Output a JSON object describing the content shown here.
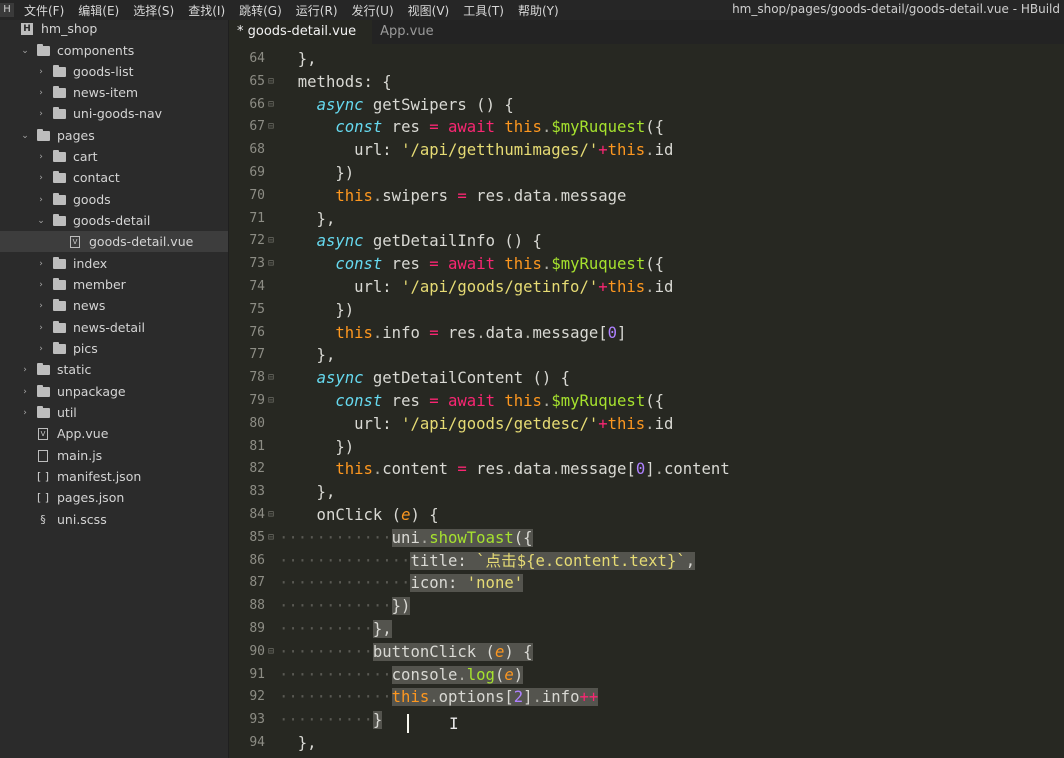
{
  "menubar": {
    "logo": "H",
    "items": [
      "文件(F)",
      "编辑(E)",
      "选择(S)",
      "查找(I)",
      "跳转(G)",
      "运行(R)",
      "发行(U)",
      "视图(V)",
      "工具(T)",
      "帮助(Y)"
    ],
    "window_title": "hm_shop/pages/goods-detail/goods-detail.vue - HBuild"
  },
  "sidebar": {
    "items": [
      {
        "label": "hm_shop",
        "kind": "project"
      },
      {
        "label": "components",
        "kind": "folder"
      },
      {
        "label": "goods-list",
        "kind": "folder"
      },
      {
        "label": "news-item",
        "kind": "folder"
      },
      {
        "label": "uni-goods-nav",
        "kind": "folder"
      },
      {
        "label": "pages",
        "kind": "folder"
      },
      {
        "label": "cart",
        "kind": "folder"
      },
      {
        "label": "contact",
        "kind": "folder"
      },
      {
        "label": "goods",
        "kind": "folder"
      },
      {
        "label": "goods-detail",
        "kind": "folder"
      },
      {
        "label": "goods-detail.vue",
        "kind": "vue"
      },
      {
        "label": "index",
        "kind": "folder"
      },
      {
        "label": "member",
        "kind": "folder"
      },
      {
        "label": "news",
        "kind": "folder"
      },
      {
        "label": "news-detail",
        "kind": "folder"
      },
      {
        "label": "pics",
        "kind": "folder"
      },
      {
        "label": "static",
        "kind": "folder"
      },
      {
        "label": "unpackage",
        "kind": "folder"
      },
      {
        "label": "util",
        "kind": "folder"
      },
      {
        "label": "App.vue",
        "kind": "vue"
      },
      {
        "label": "main.js",
        "kind": "file"
      },
      {
        "label": "manifest.json",
        "kind": "json"
      },
      {
        "label": "pages.json",
        "kind": "json"
      },
      {
        "label": "uni.scss",
        "kind": "scss"
      }
    ]
  },
  "tabs": [
    {
      "label": "* goods-detail.vue",
      "active": true
    },
    {
      "label": "App.vue",
      "active": false
    }
  ],
  "editor": {
    "lines": [
      {
        "n": "64",
        "text": "  },"
      },
      {
        "n": "65",
        "text": "  methods: {"
      },
      {
        "n": "66",
        "text": "    async getSwipers () {"
      },
      {
        "n": "67",
        "text": "      const res = await this.$myRuquest({"
      },
      {
        "n": "68",
        "text": "        url: '/api/getthumimages/'+this.id"
      },
      {
        "n": "69",
        "text": "      })"
      },
      {
        "n": "70",
        "text": "      this.swipers = res.data.message"
      },
      {
        "n": "71",
        "text": "    },"
      },
      {
        "n": "72",
        "text": "    async getDetailInfo () {"
      },
      {
        "n": "73",
        "text": "      const res = await this.$myRuquest({"
      },
      {
        "n": "74",
        "text": "        url: '/api/goods/getinfo/'+this.id"
      },
      {
        "n": "75",
        "text": "      })"
      },
      {
        "n": "76",
        "text": "      this.info = res.data.message[0]"
      },
      {
        "n": "77",
        "text": "    },"
      },
      {
        "n": "78",
        "text": "    async getDetailContent () {"
      },
      {
        "n": "79",
        "text": "      const res = await this.$myRuquest({"
      },
      {
        "n": "80",
        "text": "        url: '/api/goods/getdesc/'+this.id"
      },
      {
        "n": "81",
        "text": "      })"
      },
      {
        "n": "82",
        "text": "      this.content = res.data.message[0].content"
      },
      {
        "n": "83",
        "text": "    },"
      },
      {
        "n": "84",
        "text": "    onClick (e) {"
      },
      {
        "n": "85",
        "text": "            uni.showToast({"
      },
      {
        "n": "86",
        "text": "              title: `点击${e.content.text}`,"
      },
      {
        "n": "87",
        "text": "              icon: 'none'"
      },
      {
        "n": "88",
        "text": "            })"
      },
      {
        "n": "89",
        "text": "          },"
      },
      {
        "n": "90",
        "text": "          buttonClick (e) {"
      },
      {
        "n": "91",
        "text": "            console.log(e)"
      },
      {
        "n": "92",
        "text": "            this.options[2].info++"
      },
      {
        "n": "93",
        "text": "          }"
      },
      {
        "n": "94",
        "text": "  },"
      }
    ]
  }
}
